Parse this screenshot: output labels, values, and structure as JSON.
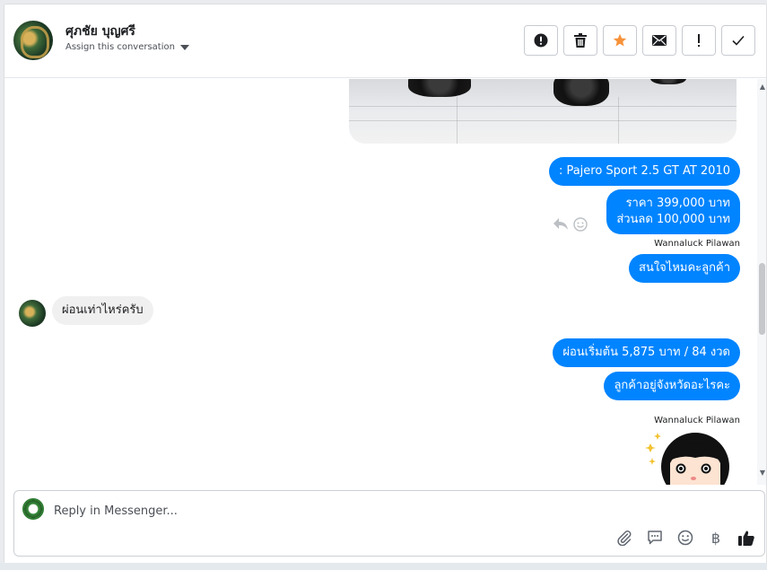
{
  "header": {
    "contact_name": "ศุภชัย บุญศรี",
    "assign_label": "Assign this conversation",
    "actions": [
      {
        "name": "report-spam-button",
        "icon": "alert-circle-icon"
      },
      {
        "name": "delete-button",
        "icon": "trash-icon"
      },
      {
        "name": "star-button",
        "icon": "star-icon",
        "color": "#f7923a"
      },
      {
        "name": "mark-unread-button",
        "icon": "envelope-icon"
      },
      {
        "name": "mark-important-button",
        "icon": "exclamation-icon"
      },
      {
        "name": "mark-done-button",
        "icon": "check-icon"
      }
    ]
  },
  "messages": {
    "m1": ": Pajero Sport 2.5 GT AT  2010",
    "m2_line1": "ราคา 399,000 บาท",
    "m2_line2": "ส่วนลด 100,000  บาท",
    "sender1": "Wannaluck Pilawan",
    "m3": "สนใจไหมคะลูกค้า",
    "incoming1": "ผ่อนเท่าไหร่ครับ",
    "m4": "ผ่อนเริ่มต้น 5,875   บาท   / 84 งวด",
    "m5": "ลูกค้าอยู่จังหวัดอะไรคะ",
    "sender2": "Wannaluck Pilawan"
  },
  "composer": {
    "placeholder": "Reply in Messenger...",
    "tools": [
      "paperclip-icon",
      "saved-reply-icon",
      "emoji-icon",
      "baht-icon",
      "thumbs-up-icon"
    ],
    "baht_symbol": "฿"
  },
  "colors": {
    "outgoing_bubble": "#0084ff",
    "incoming_bubble": "#f1f0f0",
    "star": "#f7923a"
  }
}
